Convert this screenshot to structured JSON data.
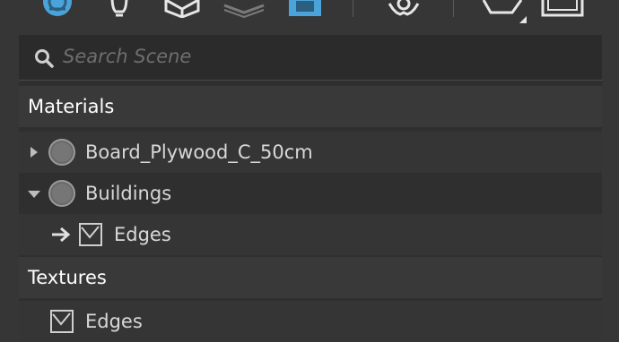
{
  "toolbar": {
    "icons": [
      "scene-materials-icon",
      "light-bulb-icon",
      "cube-icon",
      "layers-icon",
      "panel-view-icon",
      "settings-gear-icon",
      "polygon-shape-icon",
      "frame-icon"
    ]
  },
  "search": {
    "placeholder": "Search Scene"
  },
  "sections": {
    "materials": "Materials",
    "textures": "Textures"
  },
  "items": {
    "board": "Board_Plywood_C_50cm",
    "buildings": "Buildings",
    "buildings_edges": "Edges",
    "textures_edges": "Edges"
  },
  "colors": {
    "accent": "#4aa3d9",
    "panel_bg": "#2f2f2f",
    "section_bg": "#393939"
  }
}
